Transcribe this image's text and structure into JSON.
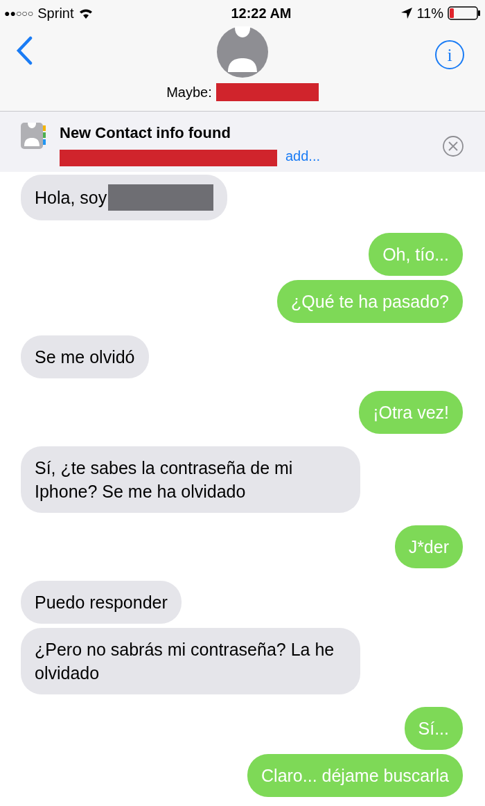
{
  "status_bar": {
    "signal": "●●○○○",
    "carrier": "Sprint",
    "time": "12:22 AM",
    "battery": "11%"
  },
  "nav": {
    "contact_label": "Maybe:",
    "contact_redacted": true,
    "info": "i"
  },
  "banner": {
    "title": "New Contact info found",
    "redacted": true,
    "link": "add..."
  },
  "messages": [
    {
      "kind": "incoming",
      "text": "Hola, soy",
      "redacted": true
    },
    {
      "kind": "outgoing",
      "text": "Oh, tío..."
    },
    {
      "kind": "outgoing",
      "text": "¿Qué te ha pasado?"
    },
    {
      "kind": "incoming",
      "text": "Se me olvidó"
    },
    {
      "kind": "outgoing",
      "text": "¡Otra vez!"
    },
    {
      "kind": "incoming",
      "text": "Sí, ¿te sabes la contraseña de mi Iphone? Se me ha olvidado"
    },
    {
      "kind": "outgoing",
      "text": "J*der"
    },
    {
      "kind": "incoming",
      "text": "Puedo responder"
    },
    {
      "kind": "incoming",
      "text": "¿Pero no sabrás mi contraseña? La he olvidado"
    },
    {
      "kind": "outgoing",
      "text": "Sí..."
    },
    {
      "kind": "outgoing",
      "text": "Claro... déjame buscarla"
    }
  ]
}
